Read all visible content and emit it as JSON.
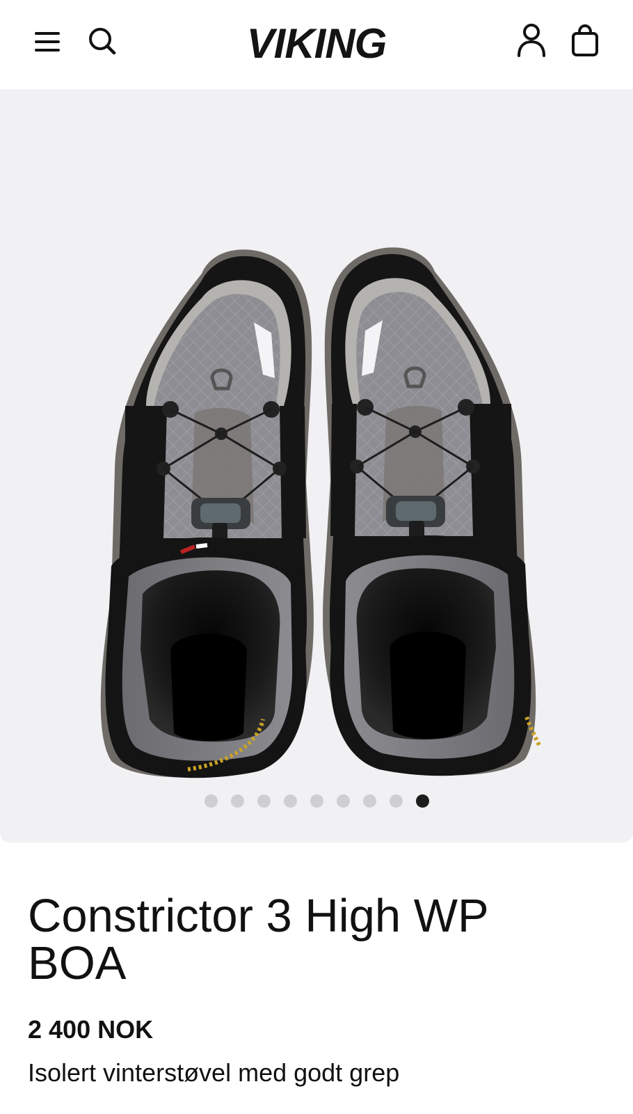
{
  "header": {
    "logo": "VIKING",
    "icons": [
      "menu-icon",
      "search-icon",
      "account-icon",
      "shopping-bag-icon"
    ]
  },
  "gallery": {
    "image": "top view of a pair of grey and black insulated winter boots with BOA laces",
    "slide_count": 9,
    "active_slide": 9
  },
  "product": {
    "title": "Constrictor 3 High WP BOA",
    "price": "2 400 NOK",
    "subtitle": "Isolert vinterstøvel med godt grep"
  },
  "colors": {
    "background": "#ffffff",
    "gallery_background": "#f1f0f2",
    "text": "#111111",
    "dot_inactive": "#cfcfd1",
    "dot_active": "#1c1c1c"
  }
}
